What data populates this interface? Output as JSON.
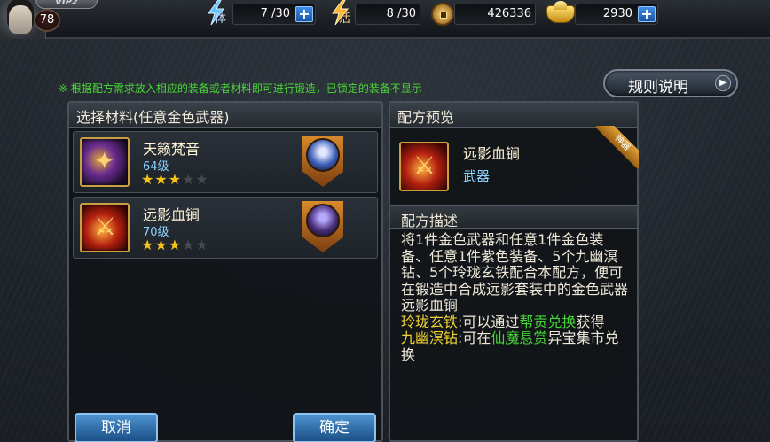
{
  "header": {
    "vip_label": "VIP2",
    "level": "78",
    "stamina": {
      "label": "体",
      "value": "7 /30"
    },
    "vitality": {
      "label": "活",
      "value": "8 /30"
    },
    "copper": {
      "value": "426336"
    },
    "gold": {
      "value": "2930"
    }
  },
  "hint": "※ 根据配方需求放入相应的装备或者材料即可进行锻造，已锁定的装备不显示",
  "rules_button": "规则说明",
  "left_panel": {
    "title": "选择材料(任意金色武器)",
    "items": [
      {
        "name": "天籁梵音",
        "level": "64级",
        "stars": 3,
        "max_stars": 5
      },
      {
        "name": "远影血锏",
        "level": "70级",
        "stars": 3,
        "max_stars": 5
      }
    ]
  },
  "right_panel": {
    "title": "配方预览",
    "preview": {
      "name": "远影血锏",
      "type": "武器",
      "badge": "神器"
    },
    "desc_title": "配方描述",
    "desc_main": "将1件金色武器和任意1件金色装备、任意1件紫色装备、5个九幽溟钻、5个玲珑玄铁配合本配方，便可在锻造中合成远影套装中的金色武器远影血锏",
    "line1_item": "玲珑玄铁",
    "line1_mid": ":可以通过",
    "line1_link": "帮贡兑换",
    "line1_end": "获得",
    "line2_item": "九幽溟钻",
    "line2_mid": ":可在",
    "line2_link": "仙魔悬赏",
    "line2_end": "异宝集市兑换"
  },
  "buttons": {
    "cancel": "取消",
    "confirm": "确定"
  },
  "colors": {
    "hint_green": "#4cd63a",
    "star_gold": "#f5c318",
    "highlight_yellow": "#f1d436",
    "button_blue": "#2f6fb0"
  }
}
